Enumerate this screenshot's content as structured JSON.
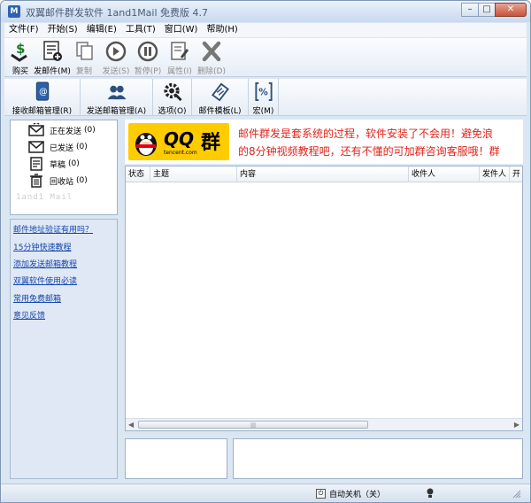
{
  "window": {
    "title": "双翼邮件群发软件 1and1Mail 免费版 4.7",
    "controls": [
      "–",
      "□",
      "✕"
    ]
  },
  "menu": [
    "文件(F)",
    "开始(S)",
    "编辑(E)",
    "工具(T)",
    "窗口(W)",
    "帮助(H)"
  ],
  "toolbar1": [
    {
      "label": "购买",
      "icon": "buy-icon"
    },
    {
      "label": "发邮件(M)",
      "icon": "send-mail-icon"
    },
    {
      "label": "复制",
      "icon": "copy-icon"
    },
    {
      "label": "发送(S)",
      "icon": "play-icon"
    },
    {
      "label": "暂停(P)",
      "icon": "pause-icon"
    },
    {
      "label": "属性(I)",
      "icon": "properties-icon"
    },
    {
      "label": "删除(D)",
      "icon": "delete-icon"
    }
  ],
  "toolbar2": [
    {
      "label": "接收邮箱管理(R)",
      "icon": "receive-mailbox-icon"
    },
    {
      "label": "发送邮箱管理(A)",
      "icon": "send-mailbox-icon"
    },
    {
      "label": "选项(O)",
      "icon": "options-icon"
    },
    {
      "label": "邮件模板(L)",
      "icon": "template-icon"
    },
    {
      "label": "宏(M)",
      "icon": "macro-icon"
    }
  ],
  "folders": [
    {
      "label": "正在发送",
      "count": "(0)",
      "icon": "sending-icon"
    },
    {
      "label": "已发送",
      "count": "(0)",
      "icon": "sent-icon"
    },
    {
      "label": "草稿",
      "count": "(0)",
      "icon": "draft-icon"
    },
    {
      "label": "回收站",
      "count": "(0)",
      "icon": "recycle-bin-icon"
    }
  ],
  "brand_text": "1and1 Mail",
  "links": [
    "邮件地址验证有用吗？",
    "15分钟快速教程",
    "添加发送邮箱教程",
    "双翼软件使用必读",
    "常用免费邮箱",
    "意见反馈"
  ],
  "banner": {
    "logo_text": "QQ",
    "logo_suffix": "群",
    "logo_domain": "tencent.com",
    "line1": "邮件群发是套系统的过程，软件安装了不会用！避免浪",
    "line2": "的8分钟视频教程吧，还有不懂的可加群咨询客服哦！群"
  },
  "grid": {
    "columns": [
      "状态",
      "主题",
      "内容",
      "收件人",
      "发件人",
      "开"
    ]
  },
  "statusbar": {
    "auto_shutdown": "自动关机（关）"
  }
}
